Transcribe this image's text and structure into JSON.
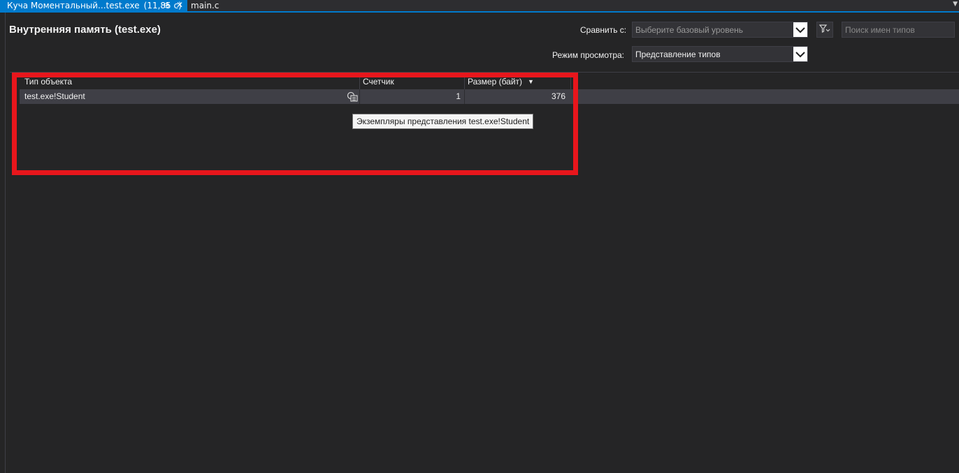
{
  "tabs": [
    {
      "title": "Куча Моментальный...test.exe",
      "duration": "(11,85 с)",
      "pin": "⊕",
      "close": "✕"
    },
    {
      "title": "main.c"
    }
  ],
  "tab_menu_icon": "chevron-down-icon",
  "page_title": "Внутренняя память (test.exe)",
  "compare": {
    "label": "Сравнить с:",
    "placeholder": "Выберите базовый уровень"
  },
  "view_mode": {
    "label": "Режим просмотра:",
    "value": "Представление типов"
  },
  "search": {
    "placeholder": "Поиск имен типов"
  },
  "table": {
    "columns": [
      "Тип объекта",
      "Счетчик",
      "Размер (байт)"
    ],
    "sort_column": "Размер (байт)",
    "rows": [
      {
        "type": "test.exe!Student",
        "count": "1",
        "size": "376"
      }
    ]
  },
  "tooltip": "Экземпляры представления test.exe!Student",
  "colors": {
    "accent": "#007acc",
    "highlight": "#e8161c",
    "background": "#252526"
  }
}
